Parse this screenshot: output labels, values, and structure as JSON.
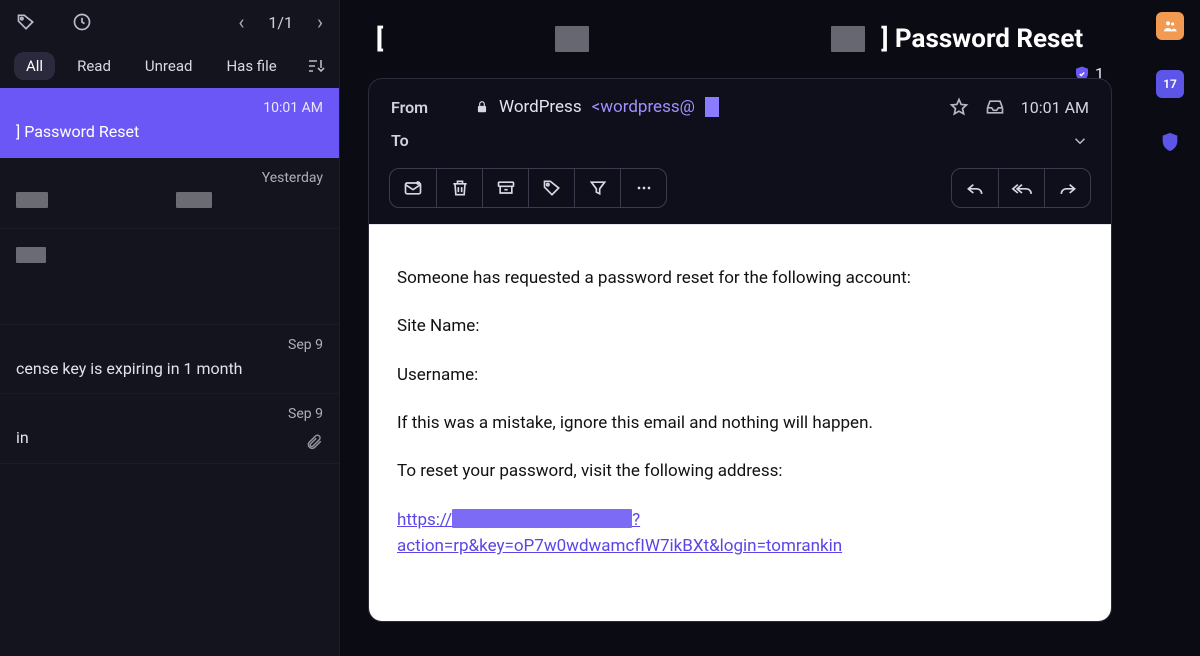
{
  "pager": {
    "label": "1/1"
  },
  "filters": {
    "all": "All",
    "read": "Read",
    "unread": "Unread",
    "hasfile": "Has file"
  },
  "list": [
    {
      "time": "10:01 AM",
      "subject": "] Password Reset"
    },
    {
      "time": "Yesterday",
      "subject": ""
    },
    {
      "time": "",
      "subject": ""
    },
    {
      "time": "Sep 9",
      "subject": "cense key is expiring in 1 month"
    },
    {
      "time": "Sep 9",
      "subject": "in"
    }
  ],
  "subject": {
    "leading_bracket": "[",
    "trailing_bracket_and_text": "] Password Reset"
  },
  "verify_count": "1",
  "header": {
    "from_label": "From",
    "to_label": "To",
    "from_name": "WordPress",
    "from_addr_prefix": "<wordpress@",
    "time": "10:01 AM"
  },
  "body": {
    "p1": "Someone has requested a password reset for the following account:",
    "p2": "Site Name:",
    "p3": "Username:",
    "p4": "If this was a mistake, ignore this email and nothing will happen.",
    "p5": "To reset your password, visit the following address:",
    "link_prefix": "https://",
    "link_suffix1": "?",
    "link_line2": "action=rp&key=oP7w0wdwamcfIW7ikBXt&login=tomrankin"
  },
  "rail": {
    "calendar_date": "17"
  }
}
